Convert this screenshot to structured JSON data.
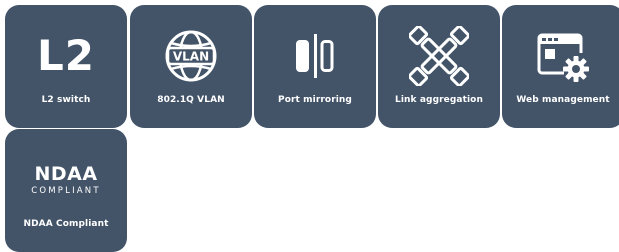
{
  "colors": {
    "tile_bg": "#435469",
    "tile_fg": "#ffffff",
    "page_bg": "#ffffff"
  },
  "tiles": [
    {
      "icon_text": "L2",
      "icon": "l2-text-icon",
      "label": "L2 switch"
    },
    {
      "icon_text": "VLAN",
      "icon": "globe-vlan-icon",
      "label": "802.1Q VLAN"
    },
    {
      "icon": "port-mirroring-icon",
      "label": "Port mirroring"
    },
    {
      "icon": "link-aggregation-icon",
      "label": "Link aggregation"
    },
    {
      "icon": "web-management-icon",
      "label": "Web management"
    },
    {
      "icon_text": "NDAA",
      "icon_subtext": "COMPLIANT",
      "icon": "ndaa-logo-icon",
      "label": "NDAA Compliant"
    }
  ]
}
